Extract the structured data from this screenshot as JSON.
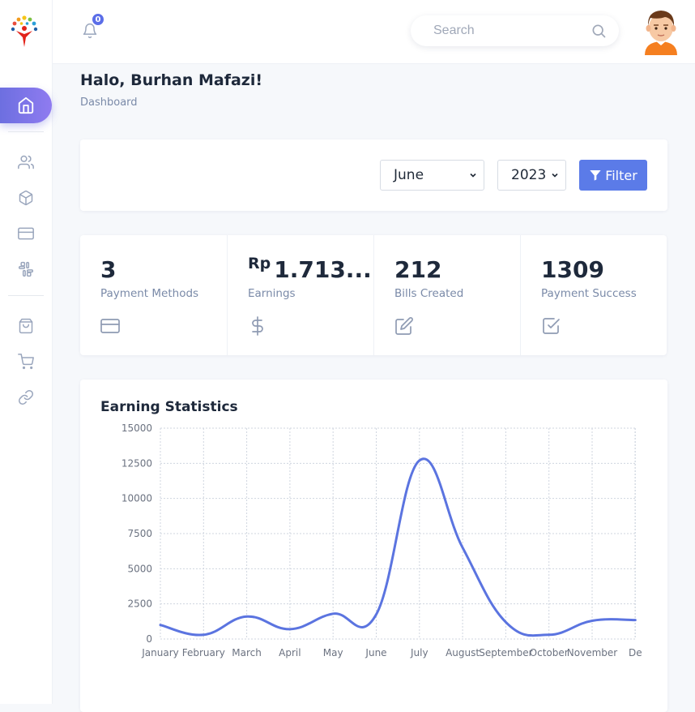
{
  "topbar": {
    "notification_count": "0",
    "search_placeholder": "Search"
  },
  "header": {
    "greeting": "Halo, Burhan Mafazi!",
    "breadcrumb": "Dashboard"
  },
  "filter": {
    "month": "June",
    "year": "2023",
    "button_label": "Filter"
  },
  "stats": [
    {
      "value": "3",
      "label": "Payment Methods",
      "icon": "credit-card-icon"
    },
    {
      "prefix": "Rp",
      "value": "1.713...",
      "label": "Earnings",
      "icon": "dollar-icon"
    },
    {
      "value": "212",
      "label": "Bills Created",
      "icon": "edit-icon"
    },
    {
      "value": "1309",
      "label": "Payment Success",
      "icon": "check-square-icon"
    }
  ],
  "sidebar": {
    "items": [
      "home-icon",
      "users-icon",
      "box-icon",
      "credit-card-icon",
      "slack-icon",
      "shopping-bag-icon",
      "cart-icon",
      "link-icon"
    ]
  },
  "colors": {
    "accent": "#5b7be8",
    "line": "#5b74e0"
  },
  "chart_data": {
    "type": "line",
    "title": "Earning Statistics",
    "categories": [
      "January",
      "February",
      "March",
      "April",
      "May",
      "June",
      "July",
      "August",
      "September",
      "October",
      "November",
      "De"
    ],
    "series": [
      {
        "values": [
          1000,
          300,
          1600,
          700,
          1800,
          1750,
          12700,
          6500,
          1200,
          300,
          1300,
          1350
        ]
      }
    ],
    "yticks": [
      "15000",
      "12500",
      "10000",
      "7500",
      "5000",
      "2500",
      "0"
    ],
    "ylim": [
      0,
      15000
    ],
    "grid": true
  }
}
